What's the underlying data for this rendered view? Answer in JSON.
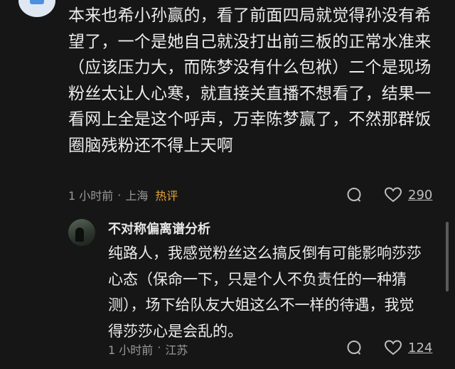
{
  "comment1": {
    "text": "本来也希小孙赢的，看了前面四局就觉得孙没有希望了，一个是她自己就没打出前三板的正常水准来（应该压力大，而陈梦没有什么包袱）二个是现场粉丝太让人心寒，就直接关直播不想看了，结果一看网上全是这个呼声，万幸陈梦赢了，不然那群饭圈脑残粉还不得上天啊",
    "time": "1 小时前",
    "dot": "·",
    "location": "上海",
    "badge": "热评",
    "likes": "290"
  },
  "comment2": {
    "username": "不对称偏离谱分析",
    "text": "纯路人，我感觉粉丝这么搞反倒有可能影响莎莎心态（保命一下，只是个人不负责任的一种猜测），场下给队友大姐这么不一样的待遇，我觉得莎莎心是会乱的。",
    "time": "1 小时前",
    "dot": "·",
    "location": "江苏",
    "likes": "124"
  },
  "colors": {
    "background": "#161616",
    "badge": "#e8a23c",
    "meta": "#9a9a9a"
  }
}
